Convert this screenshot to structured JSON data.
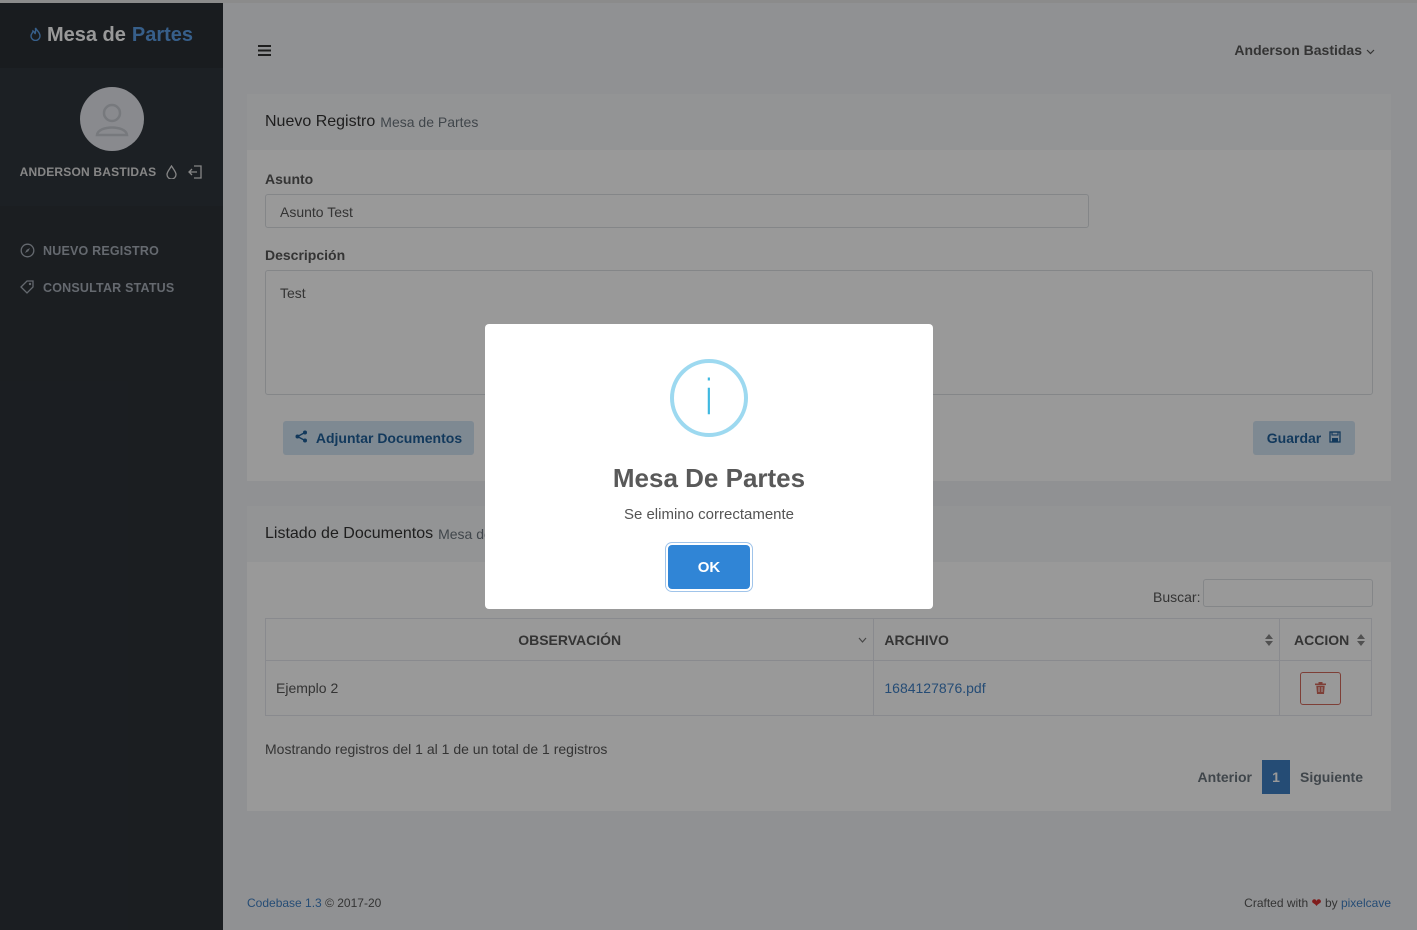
{
  "brand": {
    "part1": "Mesa de",
    "part2": "Partes",
    "icon": "flame-icon"
  },
  "sidebar": {
    "user_name": "ANDERSON BASTIDAS",
    "items": [
      {
        "label": "NUEVO REGISTRO",
        "icon": "compass-icon"
      },
      {
        "label": "CONSULTAR STATUS",
        "icon": "tag-icon"
      }
    ]
  },
  "header": {
    "menu_icon": "hamburger-icon",
    "user": "Anderson Bastidas"
  },
  "form_block": {
    "title": "Nuevo Registro",
    "subtitle": "Mesa de Partes",
    "asunto_label": "Asunto",
    "asunto_value": "Asunto Test",
    "descripcion_label": "Descripción",
    "descripcion_value": "Test",
    "attach_button": "Adjuntar Documentos",
    "save_button": "Guardar"
  },
  "list_block": {
    "title": "Listado de Documentos",
    "subtitle": "Mesa de Partes",
    "search_label": "Buscar:",
    "columns": [
      "OBSERVACIÓN",
      "ARCHIVO",
      "ACCION"
    ],
    "rows": [
      {
        "observacion": "Ejemplo 2",
        "archivo": "1684127876.pdf"
      }
    ],
    "info": "Mostrando registros del 1 al 1 de un total de 1 registros",
    "pager": {
      "prev": "Anterior",
      "current": "1",
      "next": "Siguiente"
    }
  },
  "footer": {
    "left_link": "Codebase 1.3",
    "left_text": "© 2017-20",
    "right_text": "Crafted with",
    "right_by": "by",
    "right_link": "pixelcave"
  },
  "modal": {
    "title": "Mesa De Partes",
    "text": "Se elimino correctamente",
    "ok": "OK",
    "icon": "i"
  },
  "colors": {
    "primary": "#3085d6",
    "link": "#3f7fc4",
    "sidebar": "#2d3238",
    "danger": "#d26a5c"
  }
}
